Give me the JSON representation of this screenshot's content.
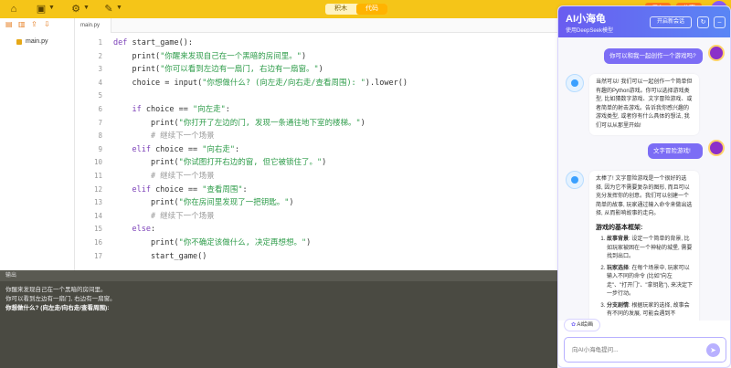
{
  "topbar": {
    "mode_tabs": [
      "积木",
      "代码"
    ],
    "active_mode": "代码",
    "save_label": "保存",
    "share_label": "分享"
  },
  "sidebar": {
    "file": "main.py"
  },
  "editor": {
    "tab": "main.py",
    "lines": [
      {
        "n": "1",
        "segments": [
          {
            "t": "def ",
            "c": "kw"
          },
          {
            "t": "start_game():",
            "c": "fn"
          }
        ]
      },
      {
        "n": "2",
        "segments": [
          {
            "t": "    print(",
            "c": "fn"
          },
          {
            "t": "\"你醒来发现自己在一个黑暗的房间里。\"",
            "c": "str"
          },
          {
            "t": ")",
            "c": "fn"
          }
        ]
      },
      {
        "n": "3",
        "segments": [
          {
            "t": "    print(",
            "c": "fn"
          },
          {
            "t": "\"你可以看到左边有一扇门, 右边有一扇窗。\"",
            "c": "str"
          },
          {
            "t": ")",
            "c": "fn"
          }
        ]
      },
      {
        "n": "4",
        "segments": [
          {
            "t": "    choice = input(",
            "c": "fn"
          },
          {
            "t": "\"你想做什么? (向左走/向右走/查看周围): \"",
            "c": "str"
          },
          {
            "t": ").lower()",
            "c": "fn"
          }
        ]
      },
      {
        "n": "5",
        "segments": []
      },
      {
        "n": "6",
        "segments": [
          {
            "t": "    if ",
            "c": "kw"
          },
          {
            "t": "choice == ",
            "c": "fn"
          },
          {
            "t": "\"向左走\"",
            "c": "str"
          },
          {
            "t": ":",
            "c": "fn"
          }
        ]
      },
      {
        "n": "7",
        "segments": [
          {
            "t": "        print(",
            "c": "fn"
          },
          {
            "t": "\"你打开了左边的门, 发现一条通往地下室的楼梯。\"",
            "c": "str"
          },
          {
            "t": ")",
            "c": "fn"
          }
        ]
      },
      {
        "n": "8",
        "segments": [
          {
            "t": "        # 继续下一个场景",
            "c": "cm"
          }
        ]
      },
      {
        "n": "9",
        "segments": [
          {
            "t": "    elif ",
            "c": "kw"
          },
          {
            "t": "choice == ",
            "c": "fn"
          },
          {
            "t": "\"向右走\"",
            "c": "str"
          },
          {
            "t": ":",
            "c": "fn"
          }
        ]
      },
      {
        "n": "10",
        "segments": [
          {
            "t": "        print(",
            "c": "fn"
          },
          {
            "t": "\"你试图打开右边的窗, 但它被锁住了。\"",
            "c": "str"
          },
          {
            "t": ")",
            "c": "fn"
          }
        ]
      },
      {
        "n": "11",
        "segments": [
          {
            "t": "        # 继续下一个场景",
            "c": "cm"
          }
        ]
      },
      {
        "n": "12",
        "segments": [
          {
            "t": "    elif ",
            "c": "kw"
          },
          {
            "t": "choice == ",
            "c": "fn"
          },
          {
            "t": "\"查看周围\"",
            "c": "str"
          },
          {
            "t": ":",
            "c": "fn"
          }
        ]
      },
      {
        "n": "13",
        "segments": [
          {
            "t": "        print(",
            "c": "fn"
          },
          {
            "t": "\"你在房间里发现了一把钥匙。\"",
            "c": "str"
          },
          {
            "t": ")",
            "c": "fn"
          }
        ]
      },
      {
        "n": "14",
        "segments": [
          {
            "t": "        # 继续下一个场景",
            "c": "cm"
          }
        ]
      },
      {
        "n": "15",
        "segments": [
          {
            "t": "    else",
            "c": "kw"
          },
          {
            "t": ":",
            "c": "fn"
          }
        ]
      },
      {
        "n": "16",
        "segments": [
          {
            "t": "        print(",
            "c": "fn"
          },
          {
            "t": "\"你不确定该做什么, 决定再想想。\"",
            "c": "str"
          },
          {
            "t": ")",
            "c": "fn"
          }
        ]
      },
      {
        "n": "17",
        "segments": [
          {
            "t": "        start_game()",
            "c": "fn"
          }
        ]
      }
    ]
  },
  "output": {
    "header": "输出",
    "lines": [
      "你醒来发现自己在一个黑暗的房间里。",
      "你可以看到左边有一扇门, 右边有一扇窗。",
      "你想做什么? (向左走/向右走/查看周围):"
    ]
  },
  "chat": {
    "title": "AI小海龟",
    "subtitle": "使用DeepSeek模型",
    "new_chat_label": "开启新会话",
    "user_msg_1": "你可以和我一起创作一个游戏吗?",
    "bot_msg_1": "当然可以! 我们可以一起创作一个简单但有趣的Python游戏。你可以选择游戏类型, 比如猜数字游戏、文字冒险游戏、或者简单的射击游戏。告诉我你感兴趣的游戏类型, 或者你有什么具体的想法, 我们可以从那里开始!",
    "user_msg_2": "文字冒险游戏!",
    "bot_msg_2_intro": "太棒了! 文字冒险游戏是一个很好的选择, 因为它不需要复杂的图形, 而且可以充分发挥你的创意。我们可以创建一个简单的故事, 玩家通过输入命令来做出选择, 从而影响故事的走向。",
    "bot_msg_2_heading": "游戏的基本框架:",
    "bot_msg_2_items": [
      {
        "term": "故事背景",
        "text": ": 设定一个简单的背景, 比如玩家被困在一个神秘的城堡, 需要找到出口。"
      },
      {
        "term": "玩家选择",
        "text": ": 在每个场景中, 玩家可以输入不同的命令 (比如\"向左走\"、\"打开门\"、\"拿钥匙\"), 来决定下一步行动。"
      },
      {
        "term": "分支剧情",
        "text": ": 根据玩家的选择, 故事会有不同的发展, 可能会遇到不"
      }
    ],
    "draw_label": "AI绘画",
    "input_placeholder": "向AI小海龟提问..."
  }
}
